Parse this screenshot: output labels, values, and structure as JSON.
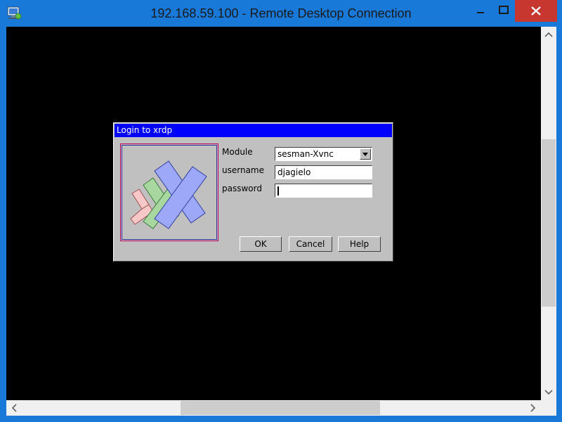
{
  "window": {
    "title": "192.168.59.100 - Remote Desktop Connection",
    "app_icon": "remote-desktop-icon",
    "controls": [
      "minimize-icon",
      "maximize-icon",
      "close-icon"
    ],
    "accent_color": "#1879d8",
    "close_color": "#c7372f"
  },
  "dialog": {
    "title": "Login to xrdp",
    "title_color": "#0000ff",
    "logo": "xrdp-logo",
    "module_label": "Module",
    "module_value": "sesman-Xvnc",
    "username_label": "username",
    "username_value": "djagielo",
    "password_label": "password",
    "password_value": "",
    "buttons": {
      "ok": "OK",
      "cancel": "Cancel",
      "help": "Help"
    }
  },
  "scrollbars": {
    "vertical": {
      "up": "chevron-up-icon",
      "down": "chevron-down-icon"
    },
    "horizontal": {
      "left": "chevron-left-icon",
      "right": "chevron-right-icon"
    }
  }
}
